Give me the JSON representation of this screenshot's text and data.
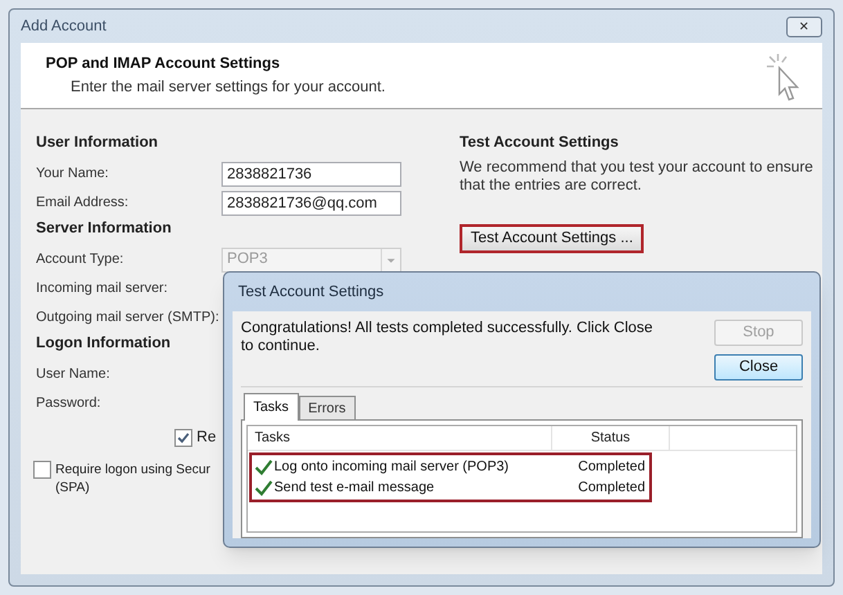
{
  "window": {
    "title": "Add Account",
    "close": "✕"
  },
  "header": {
    "title": "POP and IMAP Account Settings",
    "subtitle": "Enter the mail server settings for your account."
  },
  "left_sections": [
    {
      "heading": "User Information",
      "rows": [
        {
          "label": "Your Name:",
          "kind": "text",
          "value": "2838821736"
        },
        {
          "label": "Email Address:",
          "kind": "text",
          "value": "2838821736@qq.com"
        }
      ]
    },
    {
      "heading": "Server Information",
      "rows": [
        {
          "label": "Account Type:",
          "kind": "select",
          "value": "POP3",
          "disabled": true
        },
        {
          "label": "Incoming mail server:",
          "kind": "label"
        },
        {
          "label": "Outgoing mail server (SMTP):",
          "kind": "label"
        }
      ]
    },
    {
      "heading": "Logon Information",
      "rows": [
        {
          "label": "User Name:",
          "kind": "label"
        },
        {
          "label": "Password:",
          "kind": "label"
        }
      ]
    }
  ],
  "remember_checkbox": {
    "label": "Re",
    "checked": true
  },
  "spa_checkbox": {
    "label": "Require logon using Secur",
    "label_line2": "(SPA)",
    "checked": false
  },
  "test_section": {
    "heading": "Test Account Settings",
    "text": "We recommend that you test your account to ensure that the entries are correct.",
    "button": "Test Account Settings ..."
  },
  "dialog": {
    "title": "Test Account Settings",
    "message": "Congratulations! All tests completed successfully. Click Close to continue.",
    "buttons": [
      {
        "label": "Stop",
        "disabled": true
      },
      {
        "label": "Close",
        "disabled": false
      }
    ],
    "tabs": [
      {
        "label": "Tasks",
        "selected": true
      },
      {
        "label": "Errors",
        "selected": false
      }
    ],
    "columns": [
      "Tasks",
      "Status"
    ],
    "rows": [
      {
        "task": "Log onto incoming mail server (POP3)",
        "status": "Completed",
        "done": true
      },
      {
        "task": "Send test e-mail message",
        "status": "Completed",
        "done": true
      }
    ]
  }
}
